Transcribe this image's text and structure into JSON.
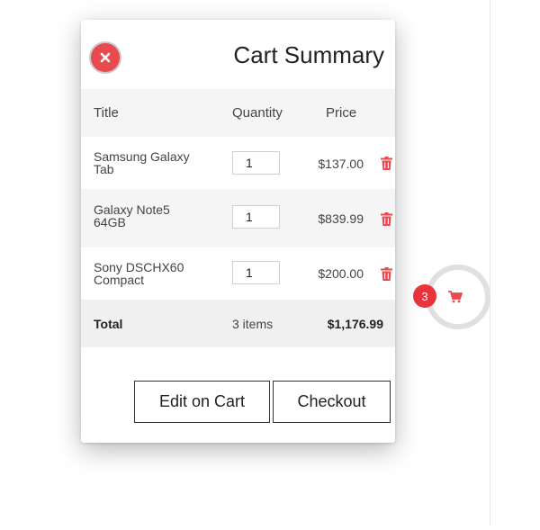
{
  "cart": {
    "title": "Cart Summary",
    "columns": {
      "title": "Title",
      "quantity": "Quantity",
      "price": "Price"
    },
    "items": [
      {
        "name": "Samsung Galaxy Tab",
        "quantity": "1",
        "price": "$137.00"
      },
      {
        "name": "Galaxy Note5 64GB",
        "quantity": "1",
        "price": "$839.99"
      },
      {
        "name": "Sony DSCHX60 Compact",
        "quantity": "1",
        "price": "$200.00"
      }
    ],
    "total": {
      "label": "Total",
      "items": "3 items",
      "amount": "$1,176.99"
    },
    "buttons": {
      "edit": "Edit on Cart",
      "checkout": "Checkout"
    }
  },
  "cart_widget": {
    "badge_count": "3"
  },
  "colors": {
    "accent": "#e74a4f",
    "badge": "#e8333a",
    "row_alt": "#f5f5f5"
  },
  "icons": {
    "close": "close-icon",
    "trash": "trash-icon",
    "cart": "shopping-cart-icon"
  }
}
